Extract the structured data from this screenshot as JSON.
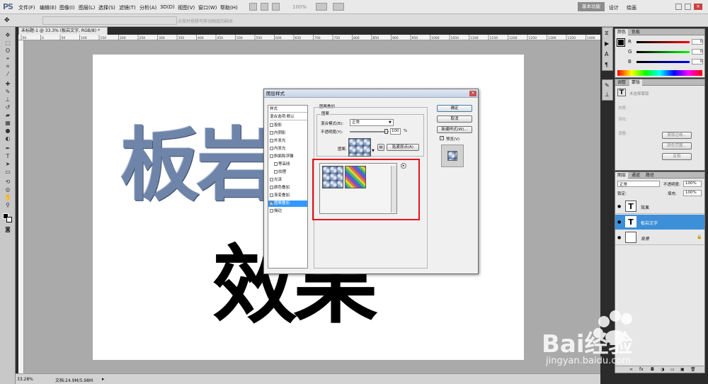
{
  "app": {
    "logo": "PS",
    "workspace_btn": "基本功能",
    "workspace_links": [
      "设计",
      "绘画"
    ]
  },
  "menu": [
    "文件(F)",
    "编辑(E)",
    "图像(I)",
    "图层(L)",
    "选择(S)",
    "滤镜(T)",
    "分析(A)",
    "3D(D)",
    "视图(V)",
    "窗口(W)",
    "帮助(H)"
  ],
  "zoom_menu": "100%",
  "options": {
    "hint": "点按并拖移可移动图层的副本"
  },
  "document": {
    "tab_title": "未标题-1 @ 33.3% (板岩文字, RGB/8) *",
    "text_top": "板岩文字",
    "text_bottom": "效果",
    "ruler_marks": [
      "50",
      "0",
      "50",
      "100",
      "150",
      "200",
      "250",
      "300",
      "350",
      "400",
      "450",
      "500",
      "550",
      "600",
      "650",
      "700",
      "750",
      "800",
      "850",
      "900",
      "950",
      "1000",
      "1050",
      "1100",
      "1150",
      "1200",
      "1250",
      "1300",
      "1350",
      "1400"
    ]
  },
  "status": {
    "zoom": "33.28%",
    "doc": "文档:24.9M/5.98M"
  },
  "panels": {
    "color": {
      "tabs": [
        "颜色",
        "色板"
      ],
      "channels": [
        "R",
        "G",
        "B"
      ],
      "values": [
        "0",
        "0",
        "0"
      ]
    },
    "adjust": {
      "tabs": [
        "调整",
        "蒙版"
      ],
      "placeholder": "未选择蒙版",
      "rows": [
        "浓度:",
        "羽化:"
      ],
      "section": "调整:",
      "buttons": [
        "蒙版边缘...",
        "颜色范围...",
        "反相"
      ]
    },
    "layers": {
      "tabs": [
        "图层",
        "通道",
        "路径"
      ],
      "blend": "正常",
      "opacity_label": "不透明度:",
      "opacity": "100%",
      "lock_label": "锁定:",
      "fill_label": "填充:",
      "fill": "100%",
      "items": [
        {
          "name": "效果"
        },
        {
          "name": "板岩文字"
        },
        {
          "name": "背景"
        }
      ]
    }
  },
  "dialog": {
    "title": "图层样式",
    "styles_header": "样式",
    "blend_default": "混合选项:默认",
    "effects": [
      "投影",
      "内阴影",
      "外发光",
      "内发光",
      "斜面和浮雕",
      "等高线",
      "纹理",
      "光泽",
      "颜色叠加",
      "渐变叠加",
      "图案叠加",
      "描边"
    ],
    "selected_effect": "图案叠加",
    "section_title": "图案叠加",
    "group_title": "图案",
    "blend_mode_label": "混合模式(B):",
    "blend_mode": "正常",
    "opacity_label": "不透明度(Y):",
    "opacity_value": "100",
    "percent": "%",
    "pattern_label": "图案:",
    "snap_button": "贴紧原点(A)",
    "ok": "确定",
    "cancel": "取消",
    "new_style": "新建样式(W)...",
    "preview_label": "预览(V)"
  },
  "watermark": {
    "brand": "Bai经验",
    "url": "jingyan.baidu.com"
  }
}
